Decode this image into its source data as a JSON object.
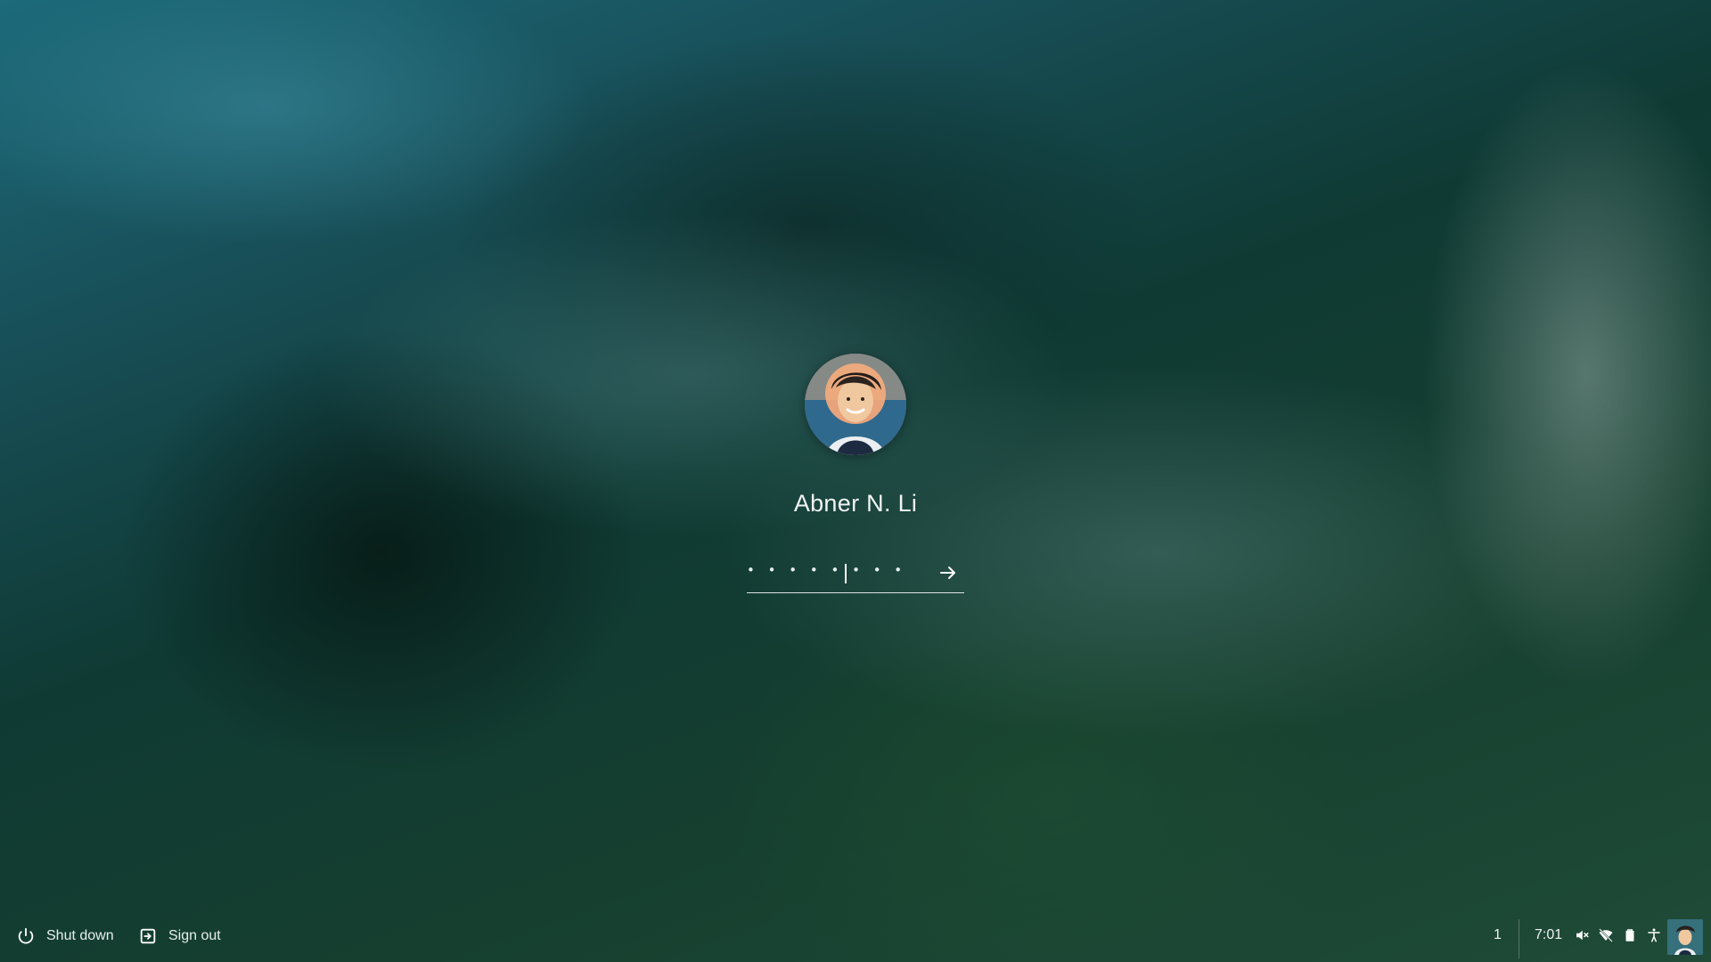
{
  "lock_screen": {
    "user_name": "Abner N. Li",
    "password_masked": "• • • • • • • •",
    "avatar_icon": "user-avatar"
  },
  "shelf": {
    "shut_down_label": "Shut down",
    "sign_out_label": "Sign out",
    "notification_count": "1",
    "time": "7:01",
    "tray_icons": [
      "volume-muted-icon",
      "wifi-off-icon",
      "battery-icon",
      "accessibility-icon"
    ]
  },
  "colors": {
    "text": "#ffffff",
    "underline": "#ffffff",
    "wallpaper_teal": "#1c6a7a",
    "wallpaper_green": "#163f2f"
  }
}
